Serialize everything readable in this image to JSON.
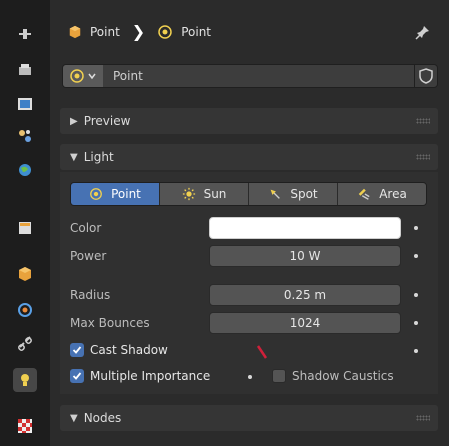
{
  "sidebar": {
    "tools": [
      {
        "icon": "tool-icon",
        "active": false
      },
      {
        "icon": "render-icon",
        "active": false
      },
      {
        "icon": "output-icon",
        "active": false
      },
      {
        "icon": "view-layer-icon",
        "active": false
      },
      {
        "icon": "scene-icon",
        "active": false
      },
      {
        "icon": "world-icon",
        "active": false
      },
      {
        "icon": "object-icon",
        "active": false
      },
      {
        "icon": "physics-icon",
        "active": false
      },
      {
        "icon": "constraints-icon",
        "active": false
      },
      {
        "icon": "light-data-icon",
        "active": true
      },
      {
        "icon": "texture-icon",
        "active": false
      }
    ]
  },
  "breadcrumb": {
    "object_name": "Point",
    "data_name": "Point"
  },
  "datablock": {
    "name": "Point"
  },
  "panels": {
    "preview": "Preview",
    "light": "Light",
    "nodes": "Nodes"
  },
  "light": {
    "types": [
      "Point",
      "Sun",
      "Spot",
      "Area"
    ],
    "active_type": "Point",
    "color_label": "Color",
    "color_value": "#ffffff",
    "power_label": "Power",
    "power_value": "10 W",
    "radius_label": "Radius",
    "radius_value": "0.25 m",
    "bounces_label": "Max Bounces",
    "bounces_value": "1024",
    "cast_shadow": {
      "label": "Cast Shadow",
      "checked": true
    },
    "multiple_importance": {
      "label": "Multiple Importance",
      "checked": true
    },
    "shadow_caustics": {
      "label": "Shadow Caustics",
      "checked": false
    }
  },
  "colors": {
    "accent": "#4772b3",
    "object_orange": "#e8a23c",
    "light_yellow": "#f0d050"
  }
}
